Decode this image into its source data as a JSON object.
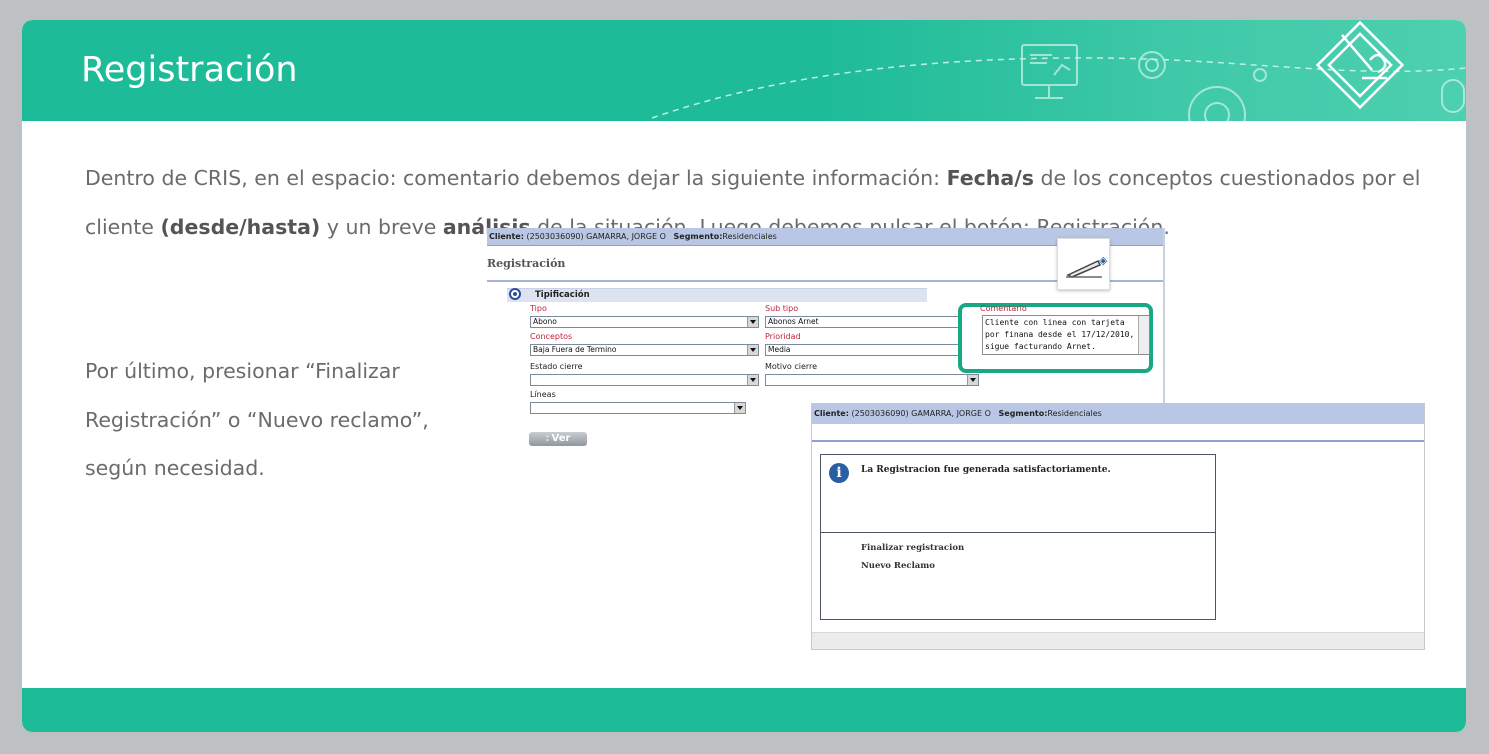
{
  "slide": {
    "title": "Registración",
    "paragraph1": {
      "t1": "Dentro de CRIS, en el espacio: comentario debemos dejar la siguiente información: ",
      "b1": "Fecha/s",
      "t2": " de los conceptos cuestionados por el cliente ",
      "b2": "(desde/hasta)",
      "t3": " y un breve ",
      "b3": "análisis",
      "t4": " de la situación. Luego debemos pulsar el botón: Registración."
    },
    "paragraph2": "Por último, presionar “Finalizar Registración” o “Nuevo reclamo”, según necesidad."
  },
  "screen1": {
    "client_label": "Cliente:",
    "client_value": "(2503036090) GAMARRA, JORGE O",
    "segment_label": "Segmento:",
    "segment_value": "Residenciales",
    "title": "Registración",
    "section": "Tipificación",
    "fields": {
      "tipo_label": "Tipo",
      "tipo_value": "Abono",
      "subtipo_label": "Sub tipo",
      "subtipo_value": "Abonos Arnet",
      "conceptos_label": "Conceptos",
      "conceptos_value": "Baja Fuera de Termino",
      "prioridad_label": "Prioridad",
      "prioridad_value": "Media",
      "estado_label": "Estado cierre",
      "estado_value": "",
      "motivo_label": "Motivo cierre",
      "motivo_value": "",
      "lineas_label": "Líneas",
      "lineas_value": ""
    },
    "comment_label": "Comentario",
    "comment_value": "Cliente con linea con tarjeta por finana desde el 17/12/2010, sigue facturando Arnet.",
    "ver_button": "Ver"
  },
  "screen2": {
    "client_label": "Cliente:",
    "client_value": "(2503036090) GAMARRA, JORGE O",
    "segment_label": "Segmento:",
    "segment_value": "Residenciales",
    "message": "La Registracion fue generada satisfactoriamente.",
    "link_finalize": "Finalizar registracion",
    "link_new": "Nuevo Reclamo"
  },
  "colors": {
    "accent": "#1dbb98",
    "text": "#6b6b6b",
    "highlight": "#1aa784"
  }
}
